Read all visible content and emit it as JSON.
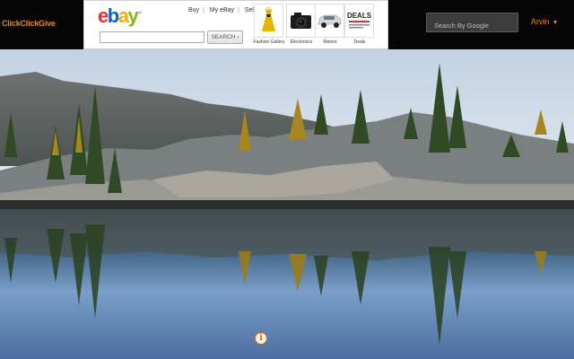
{
  "app": {
    "brand": "ClickClickGive",
    "user_name": "Arvin",
    "user_caret": "▼",
    "search_placeholder": "Search By Google"
  },
  "ad": {
    "logo": {
      "e": "e",
      "b": "b",
      "a": "a",
      "y": "y",
      "tm": "™"
    },
    "links": [
      "Buy",
      "My eBay",
      "Sell"
    ],
    "search_button": "SEARCH ›",
    "categories": [
      {
        "label": "Fashion Gallery",
        "icon": "dress-icon"
      },
      {
        "label": "Electronics",
        "icon": "camera-icon"
      },
      {
        "label": "Motors",
        "icon": "car-icon"
      },
      {
        "label": "Deals",
        "icon": "deals-icon",
        "badge": "DEALS"
      }
    ]
  },
  "info_icon": "i",
  "colors": {
    "accent": "#e8861a",
    "topbar": "#050505",
    "sky": "#cfdbe8",
    "water": "#5f86b4"
  }
}
